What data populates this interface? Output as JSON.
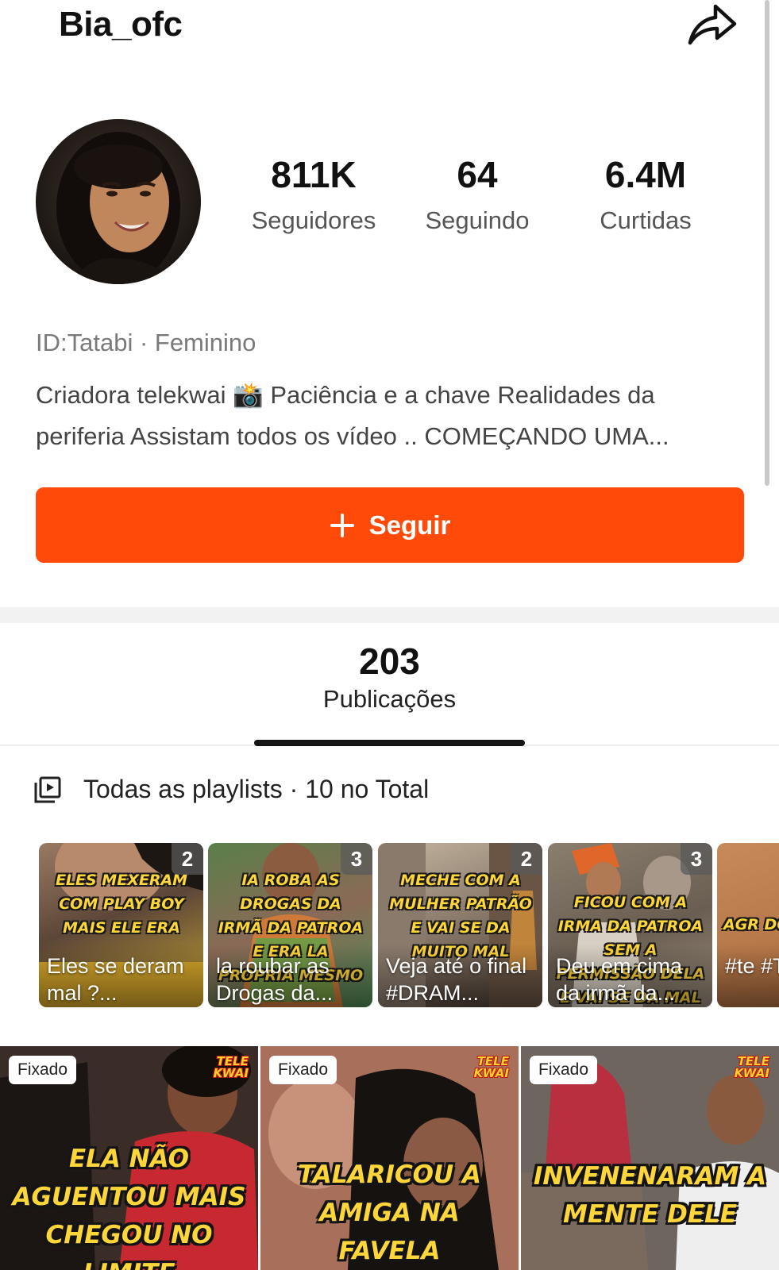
{
  "header": {
    "username": "Bia_ofc",
    "share_icon": "share-arrow-icon"
  },
  "profile": {
    "stats": [
      {
        "value": "811K",
        "label": "Seguidores"
      },
      {
        "value": "64",
        "label": "Seguindo"
      },
      {
        "value": "6.4M",
        "label": "Curtidas"
      }
    ],
    "meta": "ID:Tatabi · Feminino",
    "bio_line1": "Criadora telekwai 📸 Paciência e a chave Realidades da",
    "bio_line2": "periferia Assistam todos os vídeo .. COMEÇANDO UMA..."
  },
  "follow": {
    "icon": "plus-icon",
    "label": "Seguir",
    "color": "#ff4a0a"
  },
  "publications": {
    "count": "203",
    "label": "Publicações"
  },
  "playlists": {
    "header": "Todas as playlists · 10 no Total",
    "icon": "playlist-icon",
    "items": [
      {
        "count": "2",
        "cover_text": "ELES MEXERAM COM PLAY BOY MAIS ELE ERA",
        "title": "Eles se deram mal ?..."
      },
      {
        "count": "3",
        "cover_text": "IA ROBA AS DROGAS DA IRMÃ DA PATROA E ERA LA PROPRIA MESMO",
        "title": "la roubar as Drogas da..."
      },
      {
        "count": "2",
        "cover_text": "MECHE COM A MULHER PATRÃO E VAI SE DA MUITO MAL",
        "title": "Veja até o final #DRAM..."
      },
      {
        "count": "3",
        "cover_text": "FICOU COM A IRMA DA PATROA SEM A PERMISSÃO DELA E VAI SE DA MAL",
        "title": "Deu em cima da irmã da..."
      },
      {
        "count": "",
        "cover_text": "AGR DO",
        "title": "#te #Te"
      }
    ]
  },
  "pinned": [
    {
      "badge": "Fixado",
      "brand": "TELE KWAI",
      "cover_text": [
        "ELA NÃO",
        "AGUENTOU MAIS",
        "CHEGOU NO",
        "LIMITE"
      ]
    },
    {
      "badge": "Fixado",
      "brand": "TELE KWAI",
      "cover_text": [
        "TALARICOU A",
        "AMIGA NA",
        "FAVELA"
      ]
    },
    {
      "badge": "Fixado",
      "brand": "TELE KWAI",
      "cover_text": [
        "INVENENARAM A",
        "MENTE DELE"
      ]
    }
  ]
}
